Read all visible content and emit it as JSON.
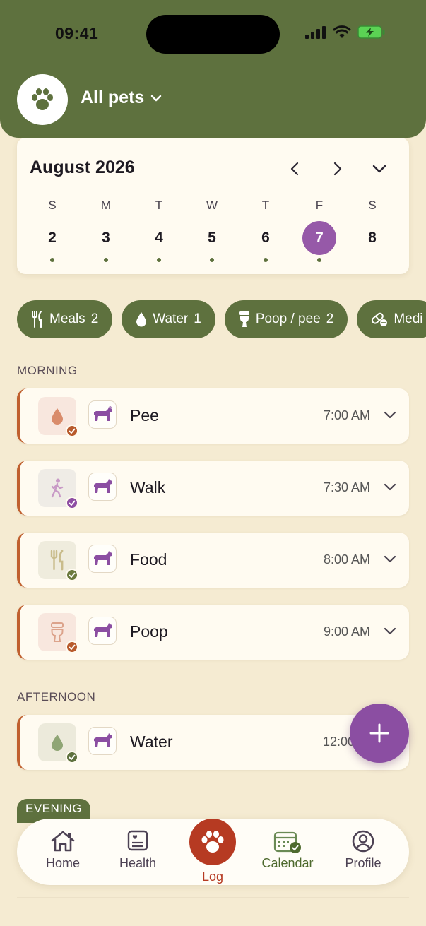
{
  "status_bar": {
    "time": "09:41"
  },
  "header": {
    "pet_selector_label": "All pets"
  },
  "calendar": {
    "month_title": "August 2026",
    "days": [
      {
        "letter": "S",
        "num": "2",
        "selected": false
      },
      {
        "letter": "M",
        "num": "3",
        "selected": false
      },
      {
        "letter": "T",
        "num": "4",
        "selected": false
      },
      {
        "letter": "W",
        "num": "5",
        "selected": false
      },
      {
        "letter": "T",
        "num": "6",
        "selected": false
      },
      {
        "letter": "F",
        "num": "7",
        "selected": true
      },
      {
        "letter": "S",
        "num": "8",
        "selected": false
      }
    ]
  },
  "chips": [
    {
      "icon": "fork-knife-icon",
      "label": "Meals",
      "count": "2"
    },
    {
      "icon": "water-drop-icon",
      "label": "Water",
      "count": "1"
    },
    {
      "icon": "toilet-icon",
      "label": "Poop / pee",
      "count": "2"
    },
    {
      "icon": "pill-icon",
      "label": "Medi",
      "count": ""
    }
  ],
  "sections": {
    "morning": "MORNING",
    "afternoon": "AFTERNOON",
    "evening": "EVENING"
  },
  "entries": [
    {
      "name": "Pee",
      "time": "7:00 AM",
      "icon": "drop-icon",
      "icon_bg": "#f8e7de",
      "icon_color": "#d98c6b",
      "check_color": "#b85a2c"
    },
    {
      "name": "Walk",
      "time": "7:30 AM",
      "icon": "walk-icon",
      "icon_bg": "#efece6",
      "icon_color": "#c89ac6",
      "check_color": "#8e4da3"
    },
    {
      "name": "Food",
      "time": "8:00 AM",
      "icon": "fork-knife-icon",
      "icon_bg": "#efecdd",
      "icon_color": "#c9bc8b",
      "check_color": "#6b7a3e"
    },
    {
      "name": "Poop",
      "time": "9:00 AM",
      "icon": "toilet-icon",
      "icon_bg": "#f8e7de",
      "icon_color": "#dca38b",
      "check_color": "#b85a2c"
    },
    {
      "name": "Water",
      "time": "12:00 P",
      "icon": "drop-icon",
      "icon_bg": "#eceadb",
      "icon_color": "#8fa575",
      "check_color": "#5e713e"
    }
  ],
  "tabs": [
    {
      "label": "Home",
      "icon": "home-icon"
    },
    {
      "label": "Health",
      "icon": "health-icon"
    },
    {
      "label": "Log",
      "icon": "paw-icon"
    },
    {
      "label": "Calendar",
      "icon": "calendar-icon"
    },
    {
      "label": "Profile",
      "icon": "profile-icon"
    }
  ],
  "colors": {
    "primary_green": "#5e713e",
    "accent_purple": "#9659a8",
    "log_red": "#b63a22",
    "background": "#f5ebd2"
  }
}
